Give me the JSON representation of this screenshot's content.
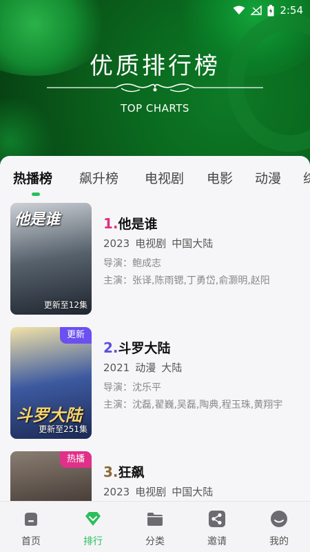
{
  "status_bar": {
    "time": "2:54"
  },
  "header": {
    "title": "优质排行榜",
    "subtitle": "TOP CHARTS"
  },
  "tabs": [
    {
      "label": "热播榜",
      "active": true
    },
    {
      "label": "飙升榜",
      "active": false
    },
    {
      "label": "电视剧",
      "active": false
    },
    {
      "label": "电影",
      "active": false
    },
    {
      "label": "动漫",
      "active": false
    },
    {
      "label": "综",
      "active": false
    }
  ],
  "items": [
    {
      "rank": "1.",
      "rank_color": "#e0307a",
      "title": "他是谁",
      "poster_title": "他是谁",
      "year": "2023",
      "genre": "电视剧",
      "region": "中国大陆",
      "director": "导演：鲍成志",
      "cast": "主演：张译,陈雨锶,丁勇岱,俞灏明,赵阳",
      "badge": "",
      "badge_color": "",
      "caption": "更新至12集",
      "poster_colors": [
        "#cdd1d6",
        "#56616c",
        "#1f2630"
      ]
    },
    {
      "rank": "2.",
      "rank_color": "#5a4fe0",
      "title": "斗罗大陆",
      "poster_title": "斗罗大陆",
      "year": "2021",
      "genre": "动漫",
      "region": "大陆",
      "director": "导演：沈乐平",
      "cast": "主演：沈磊,翟巍,吴磊,陶典,程玉珠,黄翔宇",
      "badge": "更新",
      "badge_color": "#6b4ff0",
      "caption": "更新至251集",
      "poster_colors": [
        "#f1e2a8",
        "#3d5aa0",
        "#1c2a55"
      ]
    },
    {
      "rank": "3.",
      "rank_color": "#8a6a3a",
      "title": "狂飙",
      "poster_title": "",
      "year": "2023",
      "genre": "电视剧",
      "region": "中国大陆",
      "director": "",
      "cast": "",
      "badge": "热播",
      "badge_color": "#e0308a",
      "caption": "",
      "poster_colors": [
        "#8a7d72",
        "#4a403a",
        "#2a2320"
      ]
    }
  ],
  "bottom_nav": [
    {
      "label": "首页",
      "icon": "home-icon",
      "active": false
    },
    {
      "label": "排行",
      "icon": "diamond-icon",
      "active": true
    },
    {
      "label": "分类",
      "icon": "folder-icon",
      "active": false
    },
    {
      "label": "邀请",
      "icon": "share-icon",
      "active": false
    },
    {
      "label": "我的",
      "icon": "profile-icon",
      "active": false
    }
  ],
  "colors": {
    "accent": "#2bbf5c",
    "header_green": "#0a6a1f"
  }
}
